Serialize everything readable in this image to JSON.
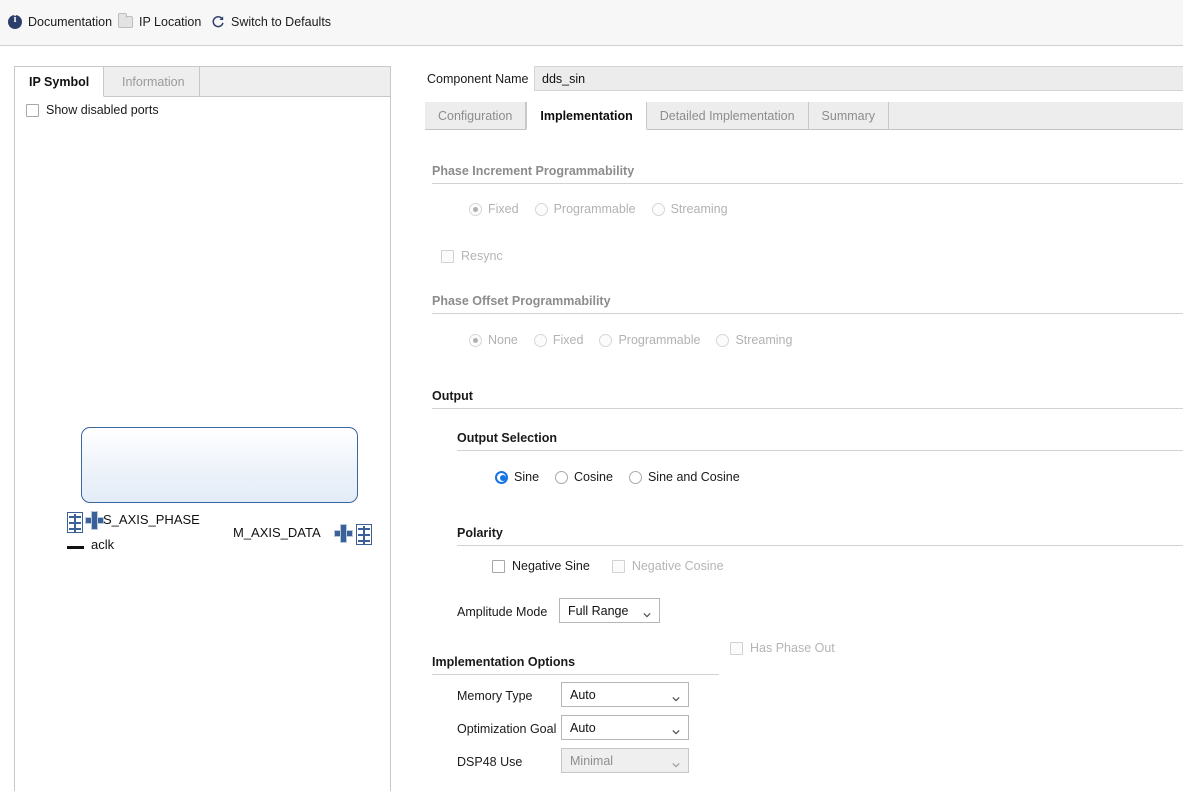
{
  "toolbar": {
    "documentation": "Documentation",
    "ip_location": "IP Location",
    "switch_defaults": "Switch to Defaults",
    "icons": {
      "documentation": "info-icon",
      "ip_location": "folder-icon",
      "switch_defaults": "refresh-icon"
    },
    "accent": "#2c3e6b"
  },
  "left_panel": {
    "tabs": [
      {
        "label": "IP Symbol",
        "active": true
      },
      {
        "label": "Information",
        "active": false
      }
    ],
    "show_disabled_ports": {
      "label": "Show disabled ports",
      "checked": false
    },
    "symbol": {
      "ports": {
        "s_axis_phase": "S_AXIS_PHASE",
        "aclk": "aclk",
        "m_axis_data": "M_AXIS_DATA"
      },
      "border_color": "#3c66a0",
      "connector_color": "#3b6098"
    }
  },
  "right_panel": {
    "component_name_label": "Component Name",
    "component_name_value": "dds_sin",
    "tabs": [
      {
        "label": "Configuration",
        "active": false
      },
      {
        "label": "Implementation",
        "active": true
      },
      {
        "label": "Detailed Implementation",
        "active": false
      },
      {
        "label": "Summary",
        "active": false
      }
    ],
    "sections": {
      "phase_increment": {
        "title": "Phase Increment Programmability",
        "enabled": false,
        "options": [
          {
            "label": "Fixed",
            "selected": true
          },
          {
            "label": "Programmable",
            "selected": false
          },
          {
            "label": "Streaming",
            "selected": false
          }
        ],
        "resync": {
          "label": "Resync",
          "checked": false,
          "enabled": false
        }
      },
      "phase_offset": {
        "title": "Phase Offset Programmability",
        "enabled": false,
        "options": [
          {
            "label": "None",
            "selected": true
          },
          {
            "label": "Fixed",
            "selected": false
          },
          {
            "label": "Programmable",
            "selected": false
          },
          {
            "label": "Streaming",
            "selected": false
          }
        ]
      },
      "output": {
        "title": "Output",
        "enabled": true,
        "output_selection": {
          "title": "Output Selection",
          "options": [
            {
              "label": "Sine",
              "selected": true
            },
            {
              "label": "Cosine",
              "selected": false
            },
            {
              "label": "Sine and Cosine",
              "selected": false
            }
          ]
        },
        "polarity": {
          "title": "Polarity",
          "negative_sine": {
            "label": "Negative Sine",
            "checked": false,
            "enabled": true
          },
          "negative_cosine": {
            "label": "Negative Cosine",
            "checked": false,
            "enabled": false
          }
        },
        "amplitude_mode": {
          "label": "Amplitude Mode",
          "value": "Full Range",
          "enabled": true
        }
      },
      "implementation_options": {
        "title": "Implementation Options",
        "memory_type": {
          "label": "Memory Type",
          "value": "Auto",
          "enabled": true
        },
        "optimization_goal": {
          "label": "Optimization Goal",
          "value": "Auto",
          "enabled": true
        },
        "dsp48_use": {
          "label": "DSP48 Use",
          "value": "Minimal",
          "enabled": false
        },
        "has_phase_out": {
          "label": "Has Phase Out",
          "checked": false,
          "enabled": false
        }
      }
    }
  }
}
